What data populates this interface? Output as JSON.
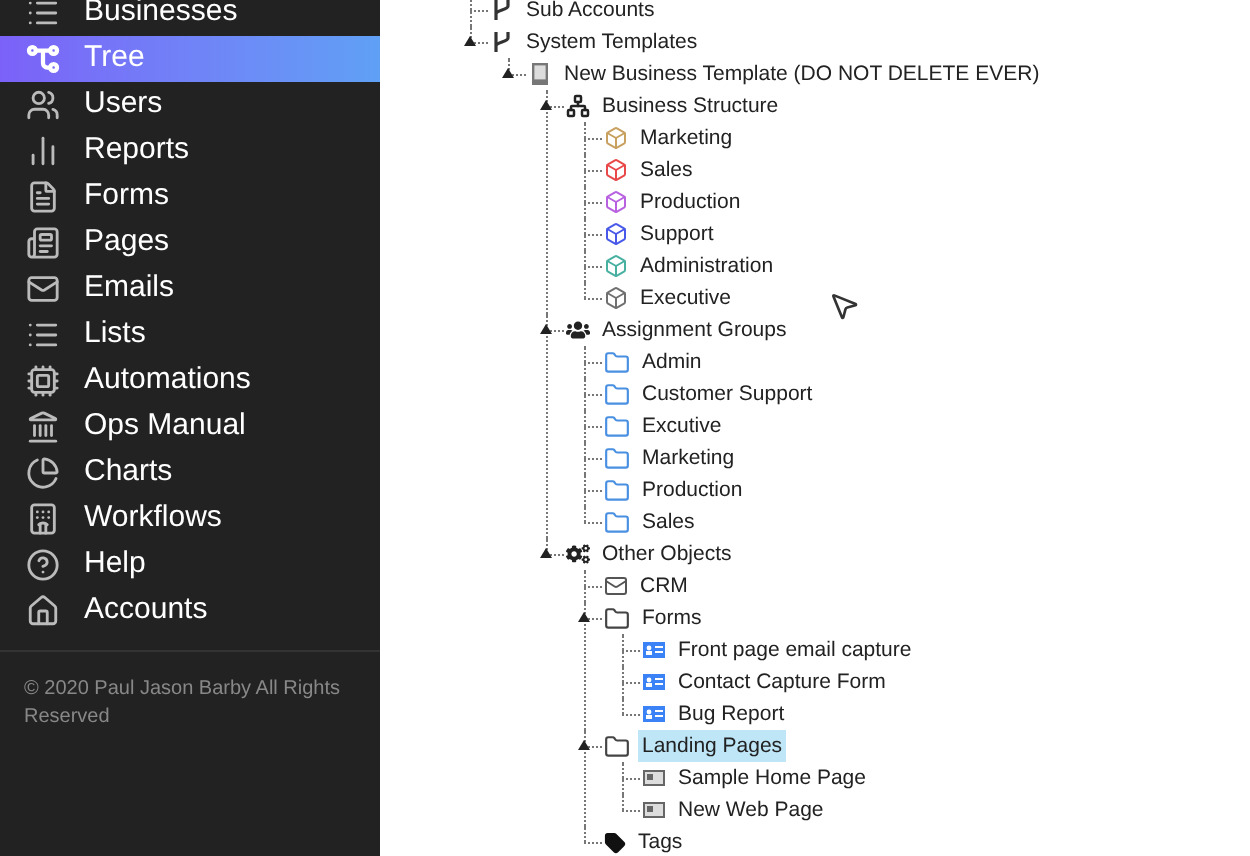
{
  "sidebar": {
    "items": [
      {
        "label": "Businesses",
        "selected": false
      },
      {
        "label": "Tree",
        "selected": true
      },
      {
        "label": "Users",
        "selected": false
      },
      {
        "label": "Reports",
        "selected": false
      },
      {
        "label": "Forms",
        "selected": false
      },
      {
        "label": "Pages",
        "selected": false
      },
      {
        "label": "Emails",
        "selected": false
      },
      {
        "label": "Lists",
        "selected": false
      },
      {
        "label": "Automations",
        "selected": false
      },
      {
        "label": "Ops Manual",
        "selected": false
      },
      {
        "label": "Charts",
        "selected": false
      },
      {
        "label": "Workflows",
        "selected": false
      },
      {
        "label": "Help",
        "selected": false
      },
      {
        "label": "Accounts",
        "selected": false
      }
    ],
    "footer": "© 2020 Paul Jason Barby All Rights Reserved"
  },
  "tree": [
    {
      "label": "Sub Accounts",
      "kind": "account",
      "expanded": false,
      "selected": false
    },
    {
      "label": "System Templates",
      "kind": "account",
      "expanded": true,
      "selected": false,
      "children": [
        {
          "label": "New Business Template (DO NOT DELETE EVER)",
          "kind": "template",
          "expanded": true,
          "selected": false,
          "children": [
            {
              "label": "Business Structure",
              "kind": "structure",
              "expanded": true,
              "selected": false,
              "children": [
                {
                  "label": "Marketing",
                  "kind": "department",
                  "color": "#c8a060",
                  "expanded": false,
                  "selected": false
                },
                {
                  "label": "Sales",
                  "kind": "department",
                  "color": "#e84848",
                  "expanded": false,
                  "selected": false
                },
                {
                  "label": "Production",
                  "kind": "department",
                  "color": "#b860e0",
                  "expanded": false,
                  "selected": false
                },
                {
                  "label": "Support",
                  "kind": "department",
                  "color": "#4858e8",
                  "expanded": false,
                  "selected": false
                },
                {
                  "label": "Administration",
                  "kind": "department",
                  "color": "#48b0a0",
                  "expanded": false,
                  "selected": false
                },
                {
                  "label": "Executive",
                  "kind": "department",
                  "color": "#707070",
                  "expanded": false,
                  "selected": false
                }
              ]
            },
            {
              "label": "Assignment Groups",
              "kind": "groups",
              "expanded": true,
              "selected": false,
              "children": [
                {
                  "label": "Admin",
                  "kind": "group",
                  "expanded": false,
                  "selected": false
                },
                {
                  "label": "Customer Support",
                  "kind": "group",
                  "expanded": false,
                  "selected": false
                },
                {
                  "label": "Excutive",
                  "kind": "group",
                  "expanded": false,
                  "selected": false
                },
                {
                  "label": "Marketing",
                  "kind": "group",
                  "expanded": false,
                  "selected": false
                },
                {
                  "label": "Production",
                  "kind": "group",
                  "expanded": false,
                  "selected": false
                },
                {
                  "label": "Sales",
                  "kind": "group",
                  "expanded": false,
                  "selected": false
                }
              ]
            },
            {
              "label": "Other Objects",
              "kind": "objects",
              "expanded": true,
              "selected": false,
              "children": [
                {
                  "label": "CRM",
                  "kind": "crm",
                  "expanded": false,
                  "selected": false
                },
                {
                  "label": "Forms",
                  "kind": "folder",
                  "expanded": true,
                  "selected": false,
                  "children": [
                    {
                      "label": "Front page email capture",
                      "kind": "form",
                      "expanded": false,
                      "selected": false
                    },
                    {
                      "label": "Contact Capture Form",
                      "kind": "form",
                      "expanded": false,
                      "selected": false
                    },
                    {
                      "label": "Bug Report",
                      "kind": "form",
                      "expanded": false,
                      "selected": false
                    }
                  ]
                },
                {
                  "label": "Landing Pages",
                  "kind": "folder",
                  "expanded": true,
                  "selected": true,
                  "children": [
                    {
                      "label": "Sample Home Page",
                      "kind": "page",
                      "expanded": false,
                      "selected": false
                    },
                    {
                      "label": "New Web Page",
                      "kind": "page",
                      "expanded": false,
                      "selected": false
                    }
                  ]
                },
                {
                  "label": "Tags",
                  "kind": "tags",
                  "expanded": false,
                  "selected": false
                }
              ]
            }
          ]
        }
      ]
    }
  ]
}
